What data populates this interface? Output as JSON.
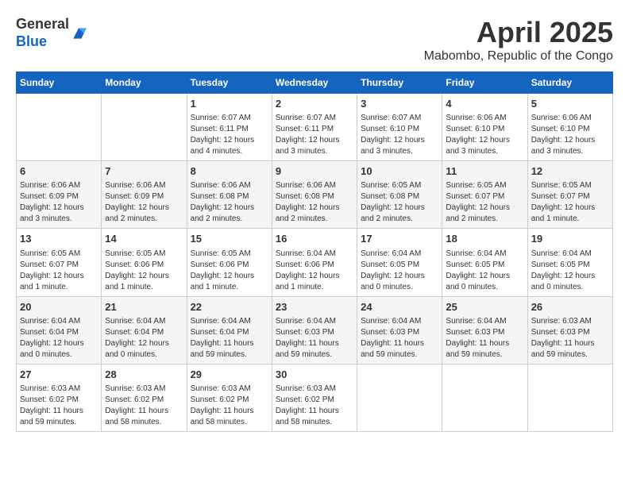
{
  "header": {
    "logo_general": "General",
    "logo_blue": "Blue",
    "month_year": "April 2025",
    "location": "Mabombo, Republic of the Congo"
  },
  "calendar": {
    "days_of_week": [
      "Sunday",
      "Monday",
      "Tuesday",
      "Wednesday",
      "Thursday",
      "Friday",
      "Saturday"
    ],
    "weeks": [
      [
        {
          "day": "",
          "details": ""
        },
        {
          "day": "",
          "details": ""
        },
        {
          "day": "1",
          "details": "Sunrise: 6:07 AM\nSunset: 6:11 PM\nDaylight: 12 hours and 4 minutes."
        },
        {
          "day": "2",
          "details": "Sunrise: 6:07 AM\nSunset: 6:11 PM\nDaylight: 12 hours and 3 minutes."
        },
        {
          "day": "3",
          "details": "Sunrise: 6:07 AM\nSunset: 6:10 PM\nDaylight: 12 hours and 3 minutes."
        },
        {
          "day": "4",
          "details": "Sunrise: 6:06 AM\nSunset: 6:10 PM\nDaylight: 12 hours and 3 minutes."
        },
        {
          "day": "5",
          "details": "Sunrise: 6:06 AM\nSunset: 6:10 PM\nDaylight: 12 hours and 3 minutes."
        }
      ],
      [
        {
          "day": "6",
          "details": "Sunrise: 6:06 AM\nSunset: 6:09 PM\nDaylight: 12 hours and 3 minutes."
        },
        {
          "day": "7",
          "details": "Sunrise: 6:06 AM\nSunset: 6:09 PM\nDaylight: 12 hours and 2 minutes."
        },
        {
          "day": "8",
          "details": "Sunrise: 6:06 AM\nSunset: 6:08 PM\nDaylight: 12 hours and 2 minutes."
        },
        {
          "day": "9",
          "details": "Sunrise: 6:06 AM\nSunset: 6:08 PM\nDaylight: 12 hours and 2 minutes."
        },
        {
          "day": "10",
          "details": "Sunrise: 6:05 AM\nSunset: 6:08 PM\nDaylight: 12 hours and 2 minutes."
        },
        {
          "day": "11",
          "details": "Sunrise: 6:05 AM\nSunset: 6:07 PM\nDaylight: 12 hours and 2 minutes."
        },
        {
          "day": "12",
          "details": "Sunrise: 6:05 AM\nSunset: 6:07 PM\nDaylight: 12 hours and 1 minute."
        }
      ],
      [
        {
          "day": "13",
          "details": "Sunrise: 6:05 AM\nSunset: 6:07 PM\nDaylight: 12 hours and 1 minute."
        },
        {
          "day": "14",
          "details": "Sunrise: 6:05 AM\nSunset: 6:06 PM\nDaylight: 12 hours and 1 minute."
        },
        {
          "day": "15",
          "details": "Sunrise: 6:05 AM\nSunset: 6:06 PM\nDaylight: 12 hours and 1 minute."
        },
        {
          "day": "16",
          "details": "Sunrise: 6:04 AM\nSunset: 6:06 PM\nDaylight: 12 hours and 1 minute."
        },
        {
          "day": "17",
          "details": "Sunrise: 6:04 AM\nSunset: 6:05 PM\nDaylight: 12 hours and 0 minutes."
        },
        {
          "day": "18",
          "details": "Sunrise: 6:04 AM\nSunset: 6:05 PM\nDaylight: 12 hours and 0 minutes."
        },
        {
          "day": "19",
          "details": "Sunrise: 6:04 AM\nSunset: 6:05 PM\nDaylight: 12 hours and 0 minutes."
        }
      ],
      [
        {
          "day": "20",
          "details": "Sunrise: 6:04 AM\nSunset: 6:04 PM\nDaylight: 12 hours and 0 minutes."
        },
        {
          "day": "21",
          "details": "Sunrise: 6:04 AM\nSunset: 6:04 PM\nDaylight: 12 hours and 0 minutes."
        },
        {
          "day": "22",
          "details": "Sunrise: 6:04 AM\nSunset: 6:04 PM\nDaylight: 11 hours and 59 minutes."
        },
        {
          "day": "23",
          "details": "Sunrise: 6:04 AM\nSunset: 6:03 PM\nDaylight: 11 hours and 59 minutes."
        },
        {
          "day": "24",
          "details": "Sunrise: 6:04 AM\nSunset: 6:03 PM\nDaylight: 11 hours and 59 minutes."
        },
        {
          "day": "25",
          "details": "Sunrise: 6:04 AM\nSunset: 6:03 PM\nDaylight: 11 hours and 59 minutes."
        },
        {
          "day": "26",
          "details": "Sunrise: 6:03 AM\nSunset: 6:03 PM\nDaylight: 11 hours and 59 minutes."
        }
      ],
      [
        {
          "day": "27",
          "details": "Sunrise: 6:03 AM\nSunset: 6:02 PM\nDaylight: 11 hours and 59 minutes."
        },
        {
          "day": "28",
          "details": "Sunrise: 6:03 AM\nSunset: 6:02 PM\nDaylight: 11 hours and 58 minutes."
        },
        {
          "day": "29",
          "details": "Sunrise: 6:03 AM\nSunset: 6:02 PM\nDaylight: 11 hours and 58 minutes."
        },
        {
          "day": "30",
          "details": "Sunrise: 6:03 AM\nSunset: 6:02 PM\nDaylight: 11 hours and 58 minutes."
        },
        {
          "day": "",
          "details": ""
        },
        {
          "day": "",
          "details": ""
        },
        {
          "day": "",
          "details": ""
        }
      ]
    ]
  }
}
